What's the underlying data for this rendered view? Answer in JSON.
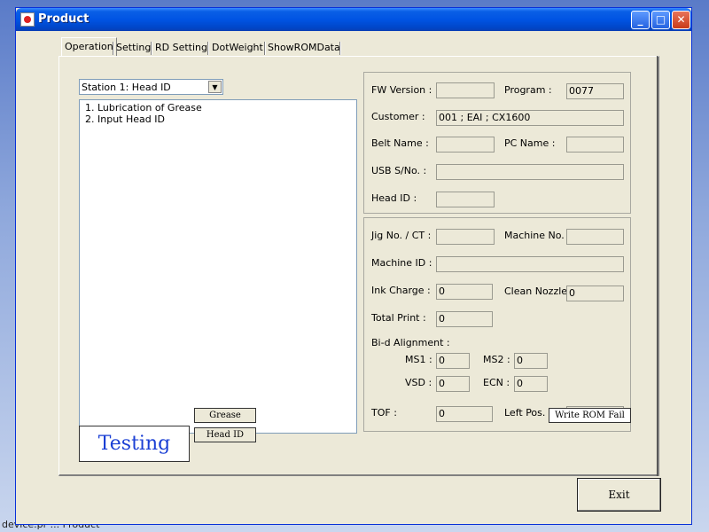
{
  "background": {
    "text": "device.pr ... Product"
  },
  "window": {
    "title": "Product",
    "minimize_label": "_",
    "maximize_label": "□",
    "close_label": "✕"
  },
  "tabs": [
    {
      "label": "Operation"
    },
    {
      "label": "Setting"
    },
    {
      "label": "RD Setting"
    },
    {
      "label": "DotWeight"
    },
    {
      "label": "ShowROMData"
    }
  ],
  "station_select": {
    "value": "Station 1: Head ID",
    "arrow": "▼"
  },
  "steps": [
    "1. Lubrication of Grease",
    "2. Input Head ID"
  ],
  "buttons": {
    "grease": "Grease",
    "head_id": "Head ID",
    "exit": "Exit",
    "write_rom_fail": "Write ROM Fail"
  },
  "status_text": "Testing",
  "info": {
    "fw_version_label": "FW Version :",
    "fw_version": "",
    "program_label": "Program :",
    "program": "0077",
    "customer_label": "Customer :",
    "customer": "001 ; EAI ; CX1600",
    "belt_name_label": "Belt Name :",
    "belt_name": "",
    "pc_name_label": "PC Name :",
    "pc_name": "",
    "usb_sno_label": "USB S/No. :",
    "usb_sno": "",
    "head_id_label": "Head ID :",
    "head_id": ""
  },
  "machine": {
    "jig_label": "Jig No. / CT :",
    "jig": "",
    "machine_no_label": "Machine No.",
    "machine_no": "",
    "machine_id_label": "Machine ID :",
    "machine_id": "",
    "ink_charge_label": "Ink Charge :",
    "ink_charge": "0",
    "clean_nozzle_label": "Clean Nozzle",
    "clean_nozzle": "0",
    "total_print_label": "Total Print :",
    "total_print": "0",
    "bid_label": "Bi-d Alignment :",
    "ms1_label": "MS1 :",
    "ms1": "0",
    "ms2_label": "MS2 :",
    "ms2": "0",
    "vsd_label": "VSD :",
    "vsd": "0",
    "ecn_label": "ECN :",
    "ecn": "0",
    "tof_label": "TOF :",
    "tof": "0",
    "left_pos_label": "Left Pos. :",
    "left_pos": ""
  }
}
